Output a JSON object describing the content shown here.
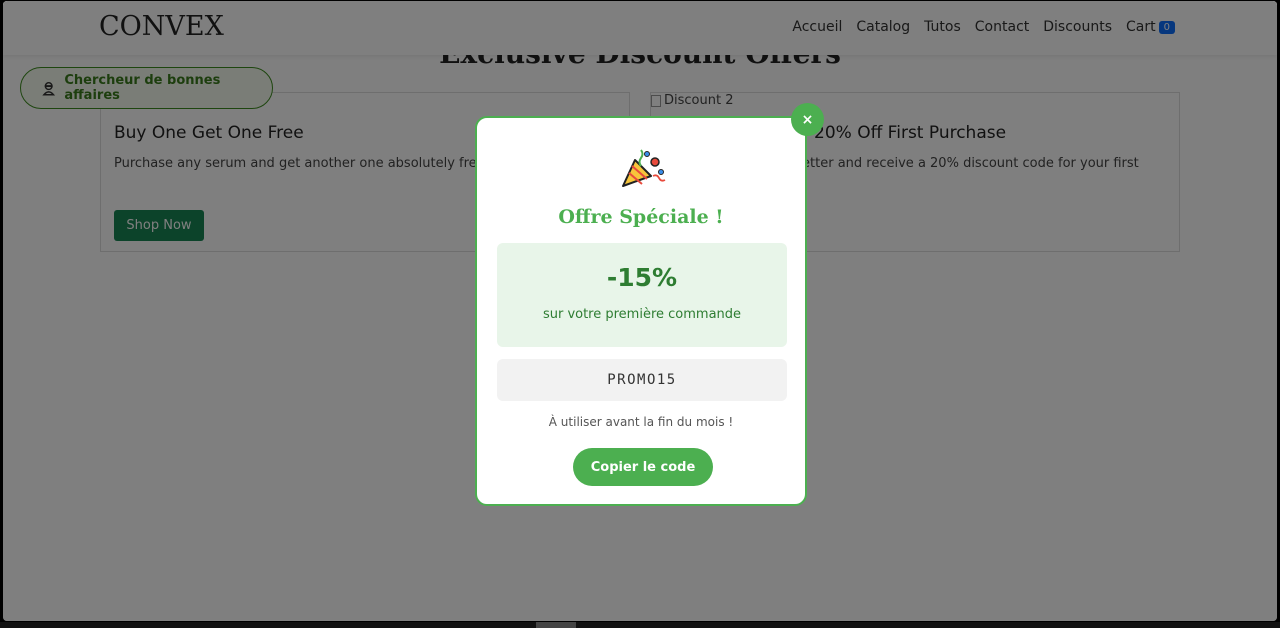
{
  "brand": "CONVEX",
  "nav": {
    "links": [
      "Accueil",
      "Catalog",
      "Tutos",
      "Contact",
      "Discounts"
    ],
    "cart_label": "Cart",
    "cart_count": "0"
  },
  "page": {
    "title": "Exclusive Discount Offers",
    "deal_hunter_label": "Chercheur de bonnes affaires"
  },
  "cards": [
    {
      "title": "Buy One Get One Free",
      "description": "Purchase any serum and get another one absolutely free. Limited time offer.",
      "button": "Shop Now"
    },
    {
      "image_alt": "Discount 2",
      "title": "20% Off First Purchase",
      "description": "Sign up for our newsletter and receive a 20% discount code for your first purchase."
    }
  ],
  "modal": {
    "close": "×",
    "title": "Offre Spéciale !",
    "discount": "-15%",
    "discount_sub": "sur votre première commande",
    "code": "PROMO15",
    "note": "À utiliser avant la fin du mois !",
    "copy_button": "Copier le code"
  },
  "colors": {
    "accent": "#4caf50",
    "accent_dark": "#2e7d32",
    "shop_button": "#198754",
    "cart_badge": "#0d6efd"
  }
}
